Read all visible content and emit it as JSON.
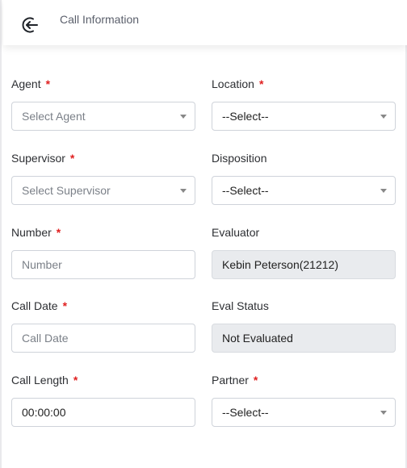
{
  "header": {
    "title": "Call Information",
    "back_icon": "back-arrow-icon"
  },
  "form": {
    "agent": {
      "label": "Agent",
      "placeholder": "Select Agent",
      "required": true
    },
    "location": {
      "label": "Location",
      "value": "--Select--",
      "required": true
    },
    "supervisor": {
      "label": "Supervisor",
      "placeholder": "Select Supervisor",
      "required": true
    },
    "disposition": {
      "label": "Disposition",
      "value": "--Select--",
      "required": false
    },
    "number": {
      "label": "Number",
      "placeholder": "Number",
      "required": true
    },
    "evaluator": {
      "label": "Evaluator",
      "value": "Kebin Peterson(21212)",
      "required": false
    },
    "call_date": {
      "label": "Call Date",
      "placeholder": "Call Date",
      "required": true
    },
    "eval_status": {
      "label": "Eval Status",
      "value": "Not Evaluated",
      "required": false
    },
    "call_length": {
      "label": "Call Length",
      "value": "00:00:00",
      "required": true
    },
    "partner": {
      "label": "Partner",
      "value": "--Select--",
      "required": true
    },
    "required_marker": "*"
  },
  "colors": {
    "required": "#e02020",
    "readonly_bg": "#e9ebee",
    "border": "#cfd3da"
  }
}
